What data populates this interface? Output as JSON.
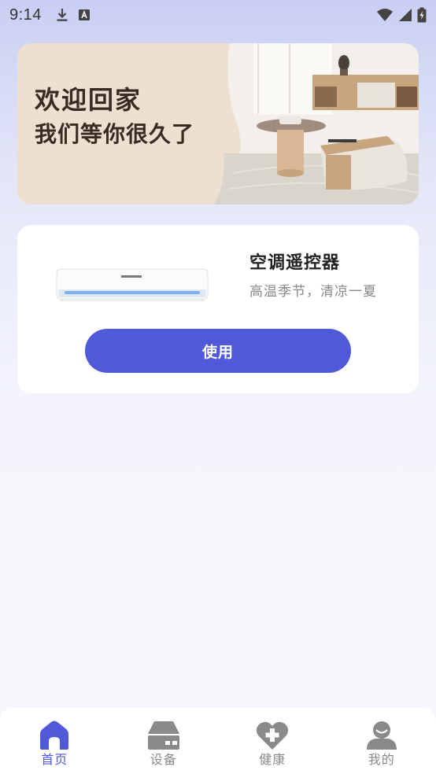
{
  "status_bar": {
    "time": "9:14",
    "left_icons": [
      "download-icon",
      "font-a-icon"
    ],
    "right_icons": [
      "wifi-icon",
      "signal-icon",
      "battery-icon"
    ]
  },
  "banner": {
    "title": "欢迎回家",
    "subtitle": "我们等你很久了",
    "image": "living-room-photo"
  },
  "device_card": {
    "image": "air-conditioner-unit",
    "title": "空调遥控器",
    "subtitle": "高温季节，清凉一夏",
    "button_label": "使用"
  },
  "bottom_nav": {
    "items": [
      {
        "label": "首页",
        "icon": "home-icon",
        "active": true
      },
      {
        "label": "设备",
        "icon": "device-icon",
        "active": false
      },
      {
        "label": "健康",
        "icon": "health-icon",
        "active": false
      },
      {
        "label": "我的",
        "icon": "profile-icon",
        "active": false
      }
    ]
  },
  "colors": {
    "accent": "#5059d8",
    "inactive": "#8a8a8a",
    "banner_bg": "#ede0d0",
    "banner_text": "#3a2a22"
  }
}
